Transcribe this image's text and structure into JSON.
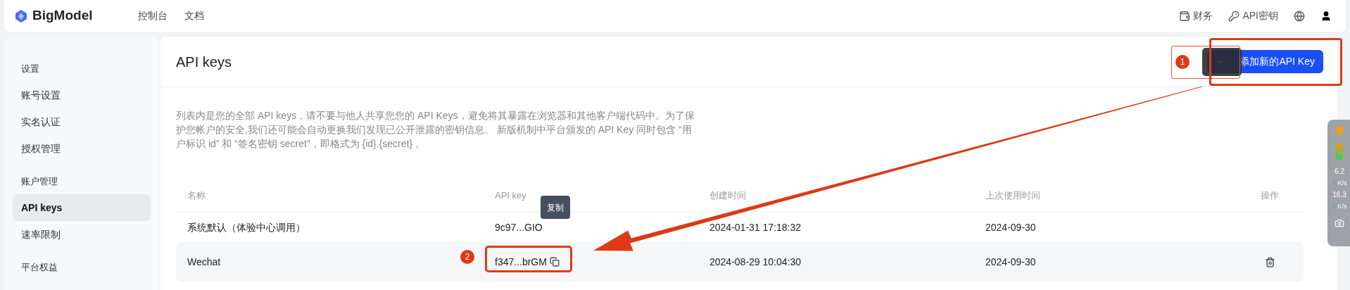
{
  "topbar": {
    "logo": "BigModel",
    "nav": [
      {
        "label": "控制台"
      },
      {
        "label": "文档"
      }
    ],
    "actions": [
      {
        "kind": "wallet",
        "label": "财务"
      },
      {
        "kind": "key",
        "label": "API密钥"
      },
      {
        "kind": "globe"
      },
      {
        "kind": "user"
      }
    ]
  },
  "sidebar": {
    "items": [
      {
        "kind": "group",
        "label": "设置",
        "selected": false
      },
      {
        "kind": "item",
        "label": "账号设置",
        "selected": false
      },
      {
        "kind": "item",
        "label": "实名认证",
        "selected": false
      },
      {
        "kind": "item",
        "label": "授权管理",
        "selected": false
      },
      {
        "kind": "group",
        "label": "账户管理",
        "selected": false
      },
      {
        "kind": "item",
        "label": "API keys",
        "selected": true
      },
      {
        "kind": "item",
        "label": "速率限制",
        "selected": false
      },
      {
        "kind": "group",
        "label": "平台权益",
        "selected": false
      }
    ]
  },
  "page": {
    "title": "API keys",
    "add_button": "添加新的API Key",
    "description": "列表内是您的全部 API keys，请不要与他人共享您您的 API Keys，避免将其暴露在浏览器和其他客户端代码中。为了保护您帐户的安全,我们还可能会自动更换我们发现已公开泄露的密钥信息。 新版机制中平台颁发的 API Key 同时包含 “用户标识 id” 和 “签名密钥 secret”，即格式为 {id}.{secret} 。"
  },
  "table": {
    "columns": [
      "名称",
      "API key",
      "创建时间",
      "上次使用时间",
      "操作"
    ],
    "rows": [
      {
        "name": "系统默认（体验中心调用）",
        "key": "9c97...GIO",
        "created": "2024-01-31 17:18:32",
        "last_used": "2024-09-30",
        "hovered": false
      },
      {
        "name": "Wechat",
        "key": "f347...brGM",
        "created": "2024-08-29 10:04:30",
        "last_used": "2024-09-30",
        "hovered": true
      }
    ]
  },
  "tooltip": "复制",
  "annotations": [
    {
      "label": "1"
    },
    {
      "label": "2"
    }
  ],
  "side_widget": {
    "up": "6.2",
    "up_unit": "K/s",
    "down": "16.3",
    "down_unit": "K/s"
  }
}
